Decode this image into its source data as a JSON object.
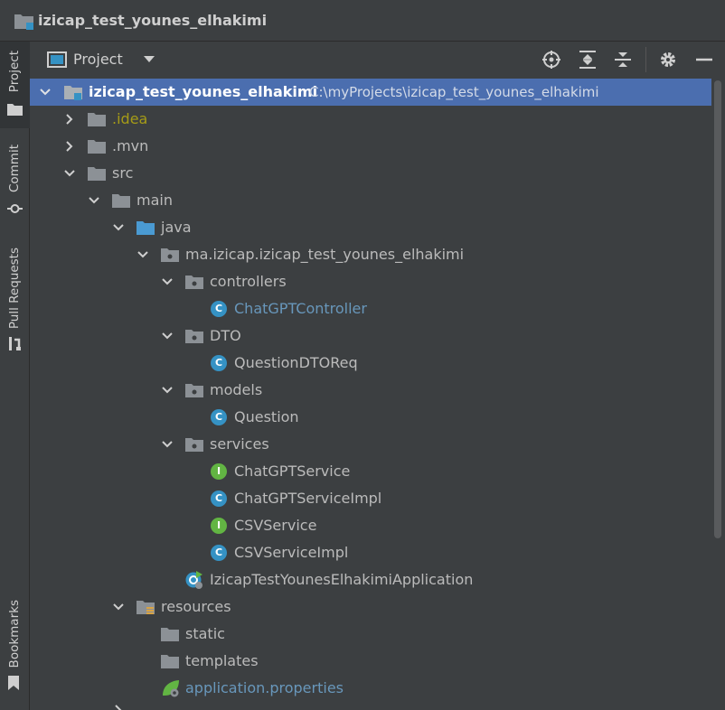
{
  "titlebar": {
    "title": "izicap_test_younes_elhakimi"
  },
  "sidebar": {
    "tabs": [
      {
        "label": "Project",
        "active": true
      },
      {
        "label": "Commit",
        "active": false
      },
      {
        "label": "Pull Requests",
        "active": false
      },
      {
        "label": "Bookmarks",
        "active": false
      }
    ]
  },
  "panel": {
    "title": "Project",
    "tools": [
      "locate-icon",
      "expand-all-icon",
      "collapse-all-icon",
      "gear-icon",
      "minimize-icon"
    ]
  },
  "tree": {
    "root": {
      "name": "izicap_test_younes_elhakimi",
      "path": "C:\\myProjects\\izicap_test_younes_elhakimi"
    },
    "items": [
      {
        "label": ".idea"
      },
      {
        "label": ".mvn"
      },
      {
        "label": "src"
      },
      {
        "label": "main"
      },
      {
        "label": "java"
      },
      {
        "label": "ma.izicap.izicap_test_younes_elhakimi"
      },
      {
        "label": "controllers"
      },
      {
        "label": "ChatGPTController",
        "badge": "C"
      },
      {
        "label": "DTO"
      },
      {
        "label": "QuestionDTOReq",
        "badge": "C"
      },
      {
        "label": "models"
      },
      {
        "label": "Question",
        "badge": "C"
      },
      {
        "label": "services"
      },
      {
        "label": "ChatGPTService",
        "badge": "I"
      },
      {
        "label": "ChatGPTServiceImpl",
        "badge": "C"
      },
      {
        "label": "CSVService",
        "badge": "I"
      },
      {
        "label": "CSVServiceImpl",
        "badge": "C"
      },
      {
        "label": "IzicapTestYounesElhakimiApplication"
      },
      {
        "label": "resources"
      },
      {
        "label": "static"
      },
      {
        "label": "templates"
      },
      {
        "label": "application.properties"
      }
    ]
  },
  "colors": {
    "background": "#3c3f41",
    "selection": "#4b6eaf",
    "folder": "#8c9196",
    "source_folder": "#4a9ad2",
    "class_badge": "#3592c4",
    "interface_badge": "#62b543",
    "modified_text": "#6897bb",
    "ignored_text": "#a59b17"
  }
}
